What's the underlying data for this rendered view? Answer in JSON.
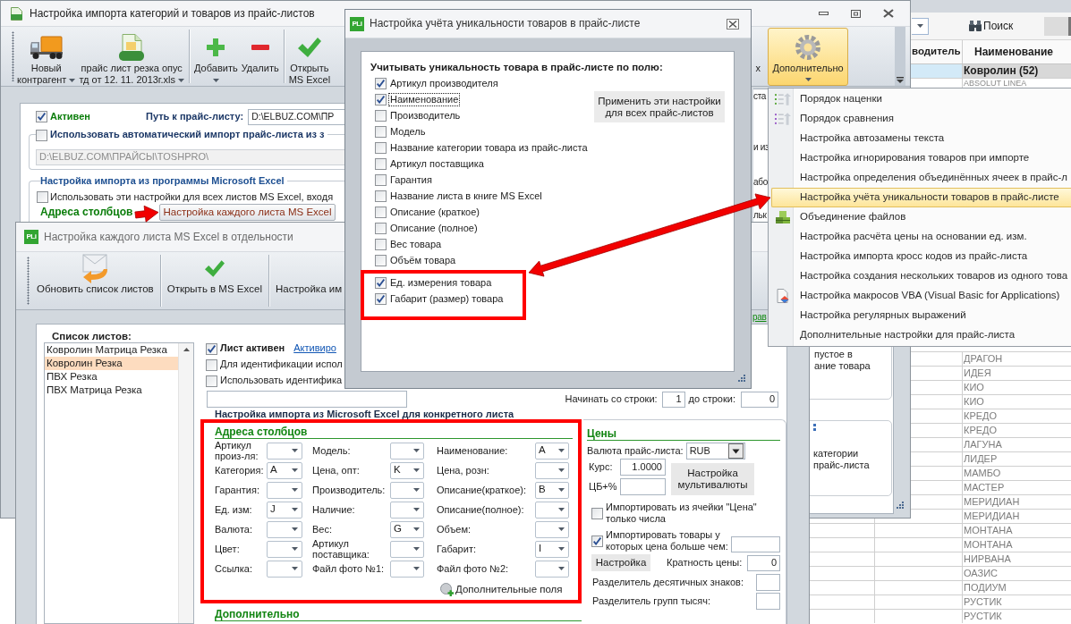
{
  "main_window": {
    "title": "Настройка импорта категорий и товаров из прайс-листов",
    "toolbar": {
      "groups": [
        [
          {
            "lines": [
              "Новый",
              "контрагент"
            ],
            "dropdown": true
          },
          {
            "lines": [
              "прайс лист резка опус",
              "тд от 12. 11. 2013г.xls"
            ],
            "dropdown": true
          }
        ],
        [
          {
            "lines": [
              "Добавить"
            ],
            "dropdown": true
          },
          {
            "lines": [
              "Удалить"
            ],
            "dropdown": false
          }
        ],
        [
          {
            "lines": [
              "Открыть",
              "MS Excel"
            ],
            "dropdown": false
          }
        ]
      ],
      "hidden_label": "х",
      "more_button": {
        "label": "Дополнительно",
        "dropdown": true,
        "pressed": true
      }
    },
    "settings": {
      "active": {
        "label": "Активен",
        "checked": true
      },
      "path": {
        "label": "Путь к прайс-листу:",
        "value": "D:\\ELBUZ.COM\\ПР"
      },
      "auto_import": {
        "label": "Использовать автоматический импорт прайс-листа из з",
        "checked": false,
        "folder": "D:\\ELBUZ.COM\\ПРАЙСЫ\\TOSHPRO\\"
      },
      "excel_import": {
        "title": "Настройка импорта из программы Microsoft Excel",
        "use_for_all": {
          "label": "Использовать эти настройки для всех листов MS Excel, входя",
          "checked": false
        },
        "columns_label": "Адреса столбцов",
        "sheet_button": "Настройка каждого листа MS Excel"
      }
    },
    "edge_fragments": [
      "ста",
      "и из",
      "або",
      "льк"
    ],
    "side_boxes": [
      [
        "пустое в",
        "ание товара"
      ],
      [
        "категории",
        "прайс-листа"
      ]
    ]
  },
  "sheet_window": {
    "logo": "PLi",
    "title": "Настройка каждого листа MS Excel в отдельности",
    "toolbar": [
      "Обновить список листов",
      "Открыть в MS Excel",
      "Настройка им"
    ],
    "edge_link": "рав",
    "sheets_label": "Список листов:",
    "sheets": [
      {
        "name": "Ковролин Матрица Резка",
        "selected": false
      },
      {
        "name": "Ковролин Резка",
        "selected": true
      },
      {
        "name": "ПВХ Резка",
        "selected": false
      },
      {
        "name": "ПВХ Матрица Резка",
        "selected": false
      }
    ],
    "sheet_active": {
      "label": "Лист активен",
      "checked": true
    },
    "activate_link": "Активиро",
    "options": [
      {
        "label": "Для идентификации испол",
        "checked": false
      },
      {
        "label": "Использовать идентифика",
        "checked": false
      }
    ],
    "start_row": {
      "label": "Начинать со строки:",
      "value": "1"
    },
    "end_row": {
      "label": "до строки:",
      "value": "0"
    },
    "import_title": "Настройка импорта из Microsoft Excel для конкретного листа",
    "column_addresses": {
      "heading": "Адреса столбцов",
      "highlighted": true,
      "rows": [
        [
          {
            "label": "Артикул произ-ля:"
          },
          {
            "label": "Модель:"
          },
          {
            "label": "Наименование:",
            "value": "A"
          }
        ],
        [
          {
            "label": "Категория:",
            "value": "A"
          },
          {
            "label": "Цена, опт:",
            "value": "K"
          },
          {
            "label": "Цена, розн:"
          }
        ],
        [
          {
            "label": "Гарантия:"
          },
          {
            "label": "Производитель:"
          },
          {
            "label": "Описание(краткое):",
            "value": "B"
          }
        ],
        [
          {
            "label": "Ед. изм:",
            "value": "J"
          },
          {
            "label": "Наличие:"
          },
          {
            "label": "Описание(полное):"
          }
        ],
        [
          {
            "label": "Валюта:"
          },
          {
            "label": "Вес:",
            "value": "G"
          },
          {
            "label": "Объем:"
          }
        ],
        [
          {
            "label": "Цвет:"
          },
          {
            "label": "Артикул поставщика:"
          },
          {
            "label": "Габарит:",
            "value": "I"
          }
        ],
        [
          {
            "label": "Ссылка:"
          },
          {
            "label": "Файл фото №1:"
          },
          {
            "label": "Файл фото №2:"
          }
        ]
      ],
      "extra_fields": "Дополнительные поля"
    },
    "more_heading": "Дополнительно",
    "prices": {
      "heading": "Цены",
      "currency": {
        "label": "Валюта прайс-листа:",
        "value": "RUB"
      },
      "rate": {
        "label": "Курс:",
        "value": "1.0000"
      },
      "cb_margin": {
        "label": "ЦБ+%"
      },
      "multicurrency_button": "Настройка мультивалюты",
      "only_numbers": {
        "label": "Импортировать из ячейки \"Цена\" только числа",
        "checked": false
      },
      "min_price": {
        "label": "Импортировать товары у которых цена больше чем:",
        "checked": true
      },
      "setup_button": "Настройка",
      "multiplicity": {
        "label": "Кратность цены:",
        "value": "0"
      },
      "decimal_separator": {
        "label": "Разделитель десятичных знаков:"
      },
      "thousands_separator": {
        "label": "Разделитель групп тысяч:"
      }
    }
  },
  "uniqueness_dialog": {
    "logo": "PLi",
    "title": "Настройка учёта уникальности товаров в прайс-листе",
    "heading": "Учитывать уникальность товара в прайс-листе по полю:",
    "fields": [
      {
        "label": "Артикул производителя",
        "checked": true,
        "focused": false,
        "highlighted": false
      },
      {
        "label": "Наименование",
        "checked": true,
        "focused": true,
        "highlighted": false
      },
      {
        "label": "Производитель",
        "checked": false,
        "focused": false,
        "highlighted": false
      },
      {
        "label": "Модель",
        "checked": false,
        "focused": false,
        "highlighted": false
      },
      {
        "label": "Название категории товара из прайс-листа",
        "checked": false,
        "focused": false,
        "highlighted": false
      },
      {
        "label": "Артикул поставщика",
        "checked": false,
        "focused": false,
        "highlighted": false
      },
      {
        "label": "Гарантия",
        "checked": false,
        "focused": false,
        "highlighted": false
      },
      {
        "label": "Название листа в книге MS Excel",
        "checked": false,
        "focused": false,
        "highlighted": false
      },
      {
        "label": "Описание (краткое)",
        "checked": false,
        "focused": false,
        "highlighted": false
      },
      {
        "label": "Описание (полное)",
        "checked": false,
        "focused": false,
        "highlighted": false
      },
      {
        "label": "Вес товара",
        "checked": false,
        "focused": false,
        "highlighted": false
      },
      {
        "label": "Объём товара",
        "checked": false,
        "focused": false,
        "highlighted": false
      },
      {
        "label": "Ед. измерения товара",
        "checked": true,
        "focused": false,
        "highlighted": true
      },
      {
        "label": "Габарит (размер) товара",
        "checked": true,
        "focused": false,
        "highlighted": true
      }
    ],
    "apply_button": "Применить эти настройки для всех прайс-листов"
  },
  "menu": {
    "items": [
      {
        "label": "Порядок наценки",
        "selected": false
      },
      {
        "label": "Порядок сравнения",
        "selected": false
      },
      {
        "label": "Настройка автозамены текста",
        "selected": false
      },
      {
        "label": "Настройка игнорирования товаров при импорте",
        "selected": false
      },
      {
        "label": "Настройка определения объединённых ячеек в прайс-л",
        "selected": false
      },
      {
        "label": "Настройка учёта уникальности товаров в прайс-листе",
        "selected": true
      },
      {
        "label": "Объединение файлов",
        "selected": false
      },
      {
        "label": "Настройка расчёта цены на основании ед. изм.",
        "selected": false
      },
      {
        "label": "Настройка импорта кросс кодов из прайс-листа",
        "selected": false
      },
      {
        "label": "Настройка создания нескольких товаров из одного това",
        "selected": false
      },
      {
        "label": "Настройка макросов VBA (Visual Basic for Applications)",
        "selected": false
      },
      {
        "label": "Настройка регулярных выражений",
        "selected": false
      },
      {
        "label": "Дополнительные настройки для прайс-листа",
        "selected": false
      }
    ]
  },
  "background_grid": {
    "search_button": "Поиск",
    "headers": [
      "водитель",
      "Наименование"
    ],
    "group_row": "Ковролин (52)",
    "rows_top": [
      "ABSOLUT LINEA"
    ],
    "rows_bottom": [
      "ДРАГОН",
      "ИДЕЯ",
      "КИО",
      "КИО",
      "КРЕДО",
      "КРЕДО",
      "ЛАГУНА",
      "ЛИДЕР",
      "МАМБО",
      "МАСТЕР",
      "МЕРИДИАН",
      "МЕРИДИАН",
      "МОНТАНА",
      "МОНТАНА",
      "НИРВАНА",
      "ОАЗИС",
      "ПОДИУМ",
      "РУСТИК",
      "РУСТИК"
    ]
  },
  "annotations": {
    "sheet_button_arrow": true,
    "double_arrow": true
  }
}
